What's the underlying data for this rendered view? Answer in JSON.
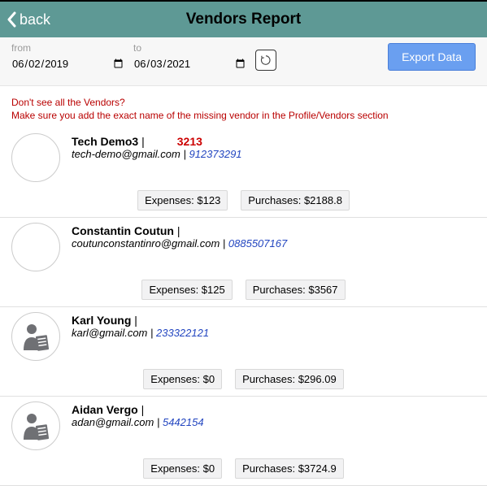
{
  "header": {
    "back_label": "back",
    "title": "Vendors Report"
  },
  "controls": {
    "from_label": "from",
    "to_label": "to",
    "from_value": "2019-06-02",
    "to_value": "2021-06-03",
    "export_label": "Export Data"
  },
  "warning": {
    "line1": "Don't see all the Vendors?",
    "line2": "Make sure you add the exact name of the missing vendor in the Profile/Vendors section"
  },
  "vendors": [
    {
      "name": "Tech Demo3",
      "highlight": "3213",
      "email": "tech-demo@gmail.com",
      "phone": "912373291",
      "expenses": "Expenses: $123",
      "purchases": "Purchases: $2188.8",
      "has_avatar_icon": false
    },
    {
      "name": "Constantin Coutun",
      "highlight": "",
      "email": "coutunconstantinro@gmail.com",
      "phone": "0885507167",
      "expenses": "Expenses: $125",
      "purchases": "Purchases: $3567",
      "has_avatar_icon": false
    },
    {
      "name": "Karl Young",
      "highlight": "",
      "email": "karl@gmail.com",
      "phone": "233322121",
      "expenses": "Expenses: $0",
      "purchases": "Purchases: $296.09",
      "has_avatar_icon": true
    },
    {
      "name": "Aidan Vergo",
      "highlight": "",
      "email": "adan@gmail.com",
      "phone": "5442154",
      "expenses": "Expenses: $0",
      "purchases": "Purchases: $3724.9",
      "has_avatar_icon": true
    }
  ]
}
